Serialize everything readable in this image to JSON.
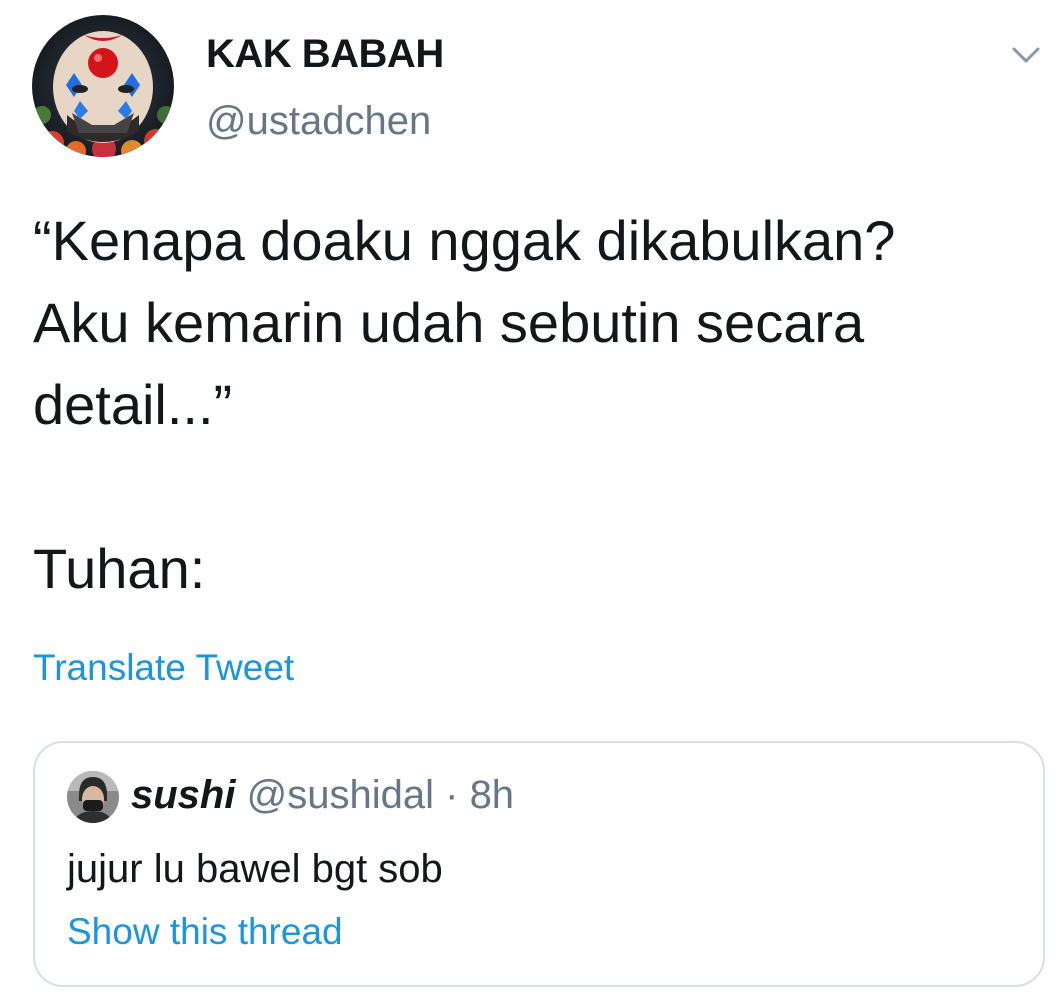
{
  "tweet": {
    "author": {
      "display_name": "KAK BABAH",
      "handle": "@ustadchen",
      "avatar_icon": "clown-avatar"
    },
    "menu_icon": "chevron-down-icon",
    "text": "“Kenapa doaku nggak dikabulkan?\nAku kemarin udah sebutin secara\ndetail...”\n\nTuhan:",
    "translate_label": "Translate Tweet"
  },
  "quoted_tweet": {
    "author": {
      "display_name": "sushi",
      "handle": "@sushidal",
      "avatar_icon": "masked-person-avatar"
    },
    "separator": "·",
    "time": "8h",
    "text": "jujur lu bawel bgt sob",
    "show_thread_label": "Show this thread"
  },
  "colors": {
    "link": "#1b95e0",
    "secondary_text": "#657786",
    "primary_text": "#14171a",
    "border": "#d8dfe4"
  }
}
